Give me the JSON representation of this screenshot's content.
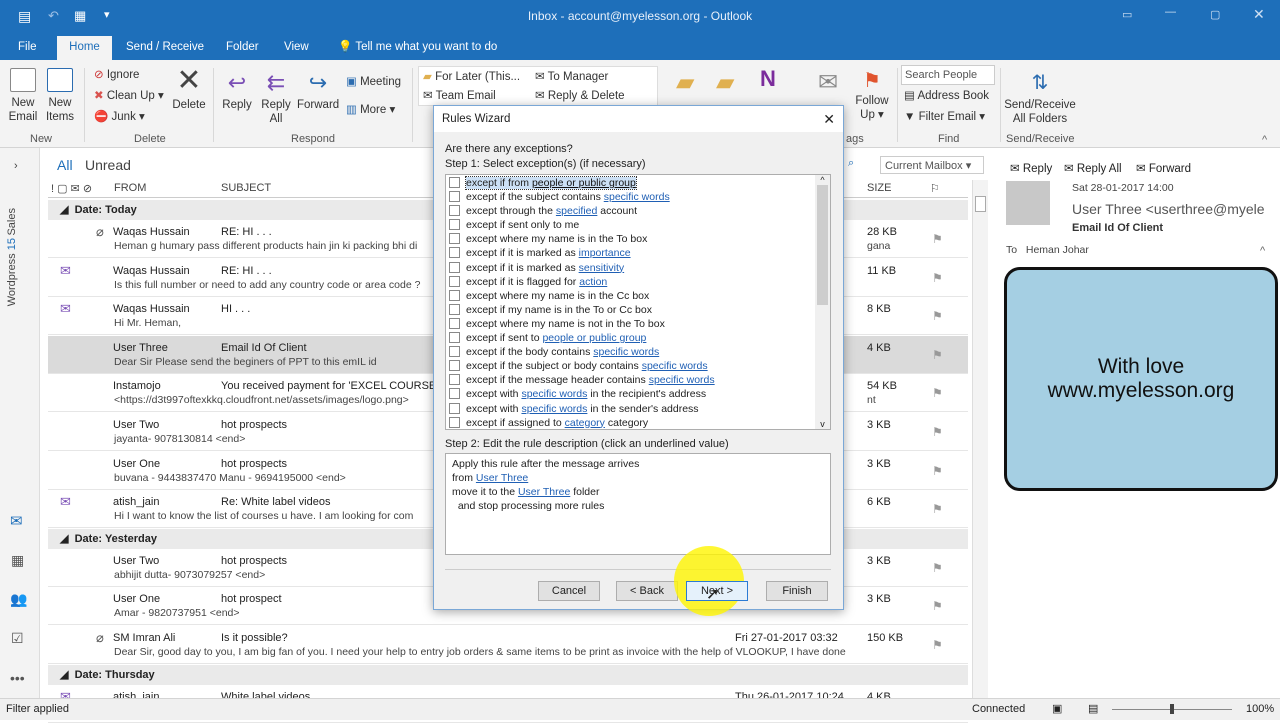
{
  "window": {
    "title": "Inbox - account@myelesson.org  -  Outlook"
  },
  "menu_tabs": [
    "File",
    "Home",
    "Send / Receive",
    "Folder",
    "View"
  ],
  "tell_me": "Tell me what you want to do",
  "ribbon": {
    "new_email": "New Email",
    "new_items": "New Items",
    "group_new": "New",
    "ignore": "Ignore",
    "clean_up": "Clean Up",
    "junk": "Junk",
    "delete": "Delete",
    "group_delete": "Delete",
    "reply": "Reply",
    "reply_all": "Reply All",
    "forward": "Forward",
    "meeting": "Meeting",
    "more": "More",
    "group_respond": "Respond",
    "qs": [
      "For Later (This...",
      "To Manager",
      "Team Email",
      "Reply & Delete"
    ],
    "follow_up": "Follow Up",
    "group_tags": "ags",
    "search_people": "Search People",
    "address_book": "Address Book",
    "filter_email": "Filter Email",
    "group_find": "Find",
    "send_receive_all": "Send/Receive All Folders",
    "group_send_receive": "Send/Receive"
  },
  "list": {
    "filter_all": "All",
    "filter_unread": "Unread",
    "scope": "Current Mailbox",
    "columns": {
      "from": "FROM",
      "subject": "SUBJECT",
      "size": "SIZE"
    },
    "groups": [
      {
        "label": "Date: Today",
        "rows": [
          {
            "from": "Waqas Hussain",
            "subject": "RE: HI . . .",
            "preview": "Heman g humary pass different products hain jin ki packing bhi di",
            "preview_tail": "gana",
            "size": "28 KB",
            "icon": "attachment"
          },
          {
            "from": "Waqas Hussain",
            "subject": "RE: HI . . .",
            "preview": "Is this full number or need to add any country code or area code ?",
            "size": "11 KB",
            "icon": "replied"
          },
          {
            "from": "Waqas Hussain",
            "subject": "HI . . .",
            "preview": "Hi Mr. Heman,",
            "size": "8 KB",
            "icon": "replied"
          },
          {
            "from": "User Three",
            "subject": "Email Id Of Client",
            "preview": "Dear Sir  Please send the beginers of PPT to this emIL id",
            "size": "4 KB",
            "selected": true
          },
          {
            "from": "Instamojo",
            "subject": "You received payment for 'EXCEL COURSE' o",
            "preview": "<https://d3t997oftexkkq.cloudfront.net/assets/images/logo.png>",
            "preview_tail": "nt",
            "size": "54 KB"
          },
          {
            "from": "User Two",
            "subject": "hot prospects",
            "preview": "jayanta- 9078130814 <end>",
            "size": "3 KB"
          },
          {
            "from": "User One",
            "subject": "hot prospects",
            "preview": "buvana - 9443837470  Manu - 9694195000 <end>",
            "size": "3 KB"
          },
          {
            "from": "atish_jain",
            "subject": "Re: White label videos",
            "preview": "Hi  I want to know the list of courses u have.  I am looking for com",
            "size": "6 KB",
            "icon": "replied"
          }
        ]
      },
      {
        "label": "Date: Yesterday",
        "rows": [
          {
            "from": "User Two",
            "subject": "hot prospects",
            "preview": "abhijit dutta- 9073079257 <end>",
            "size": "3 KB"
          },
          {
            "from": "User One",
            "subject": "hot prospect",
            "preview": "Amar - 9820737951 <end>",
            "size": "3 KB"
          },
          {
            "from": "SM Imran Ali",
            "subject": "Is it possible?",
            "preview": "Dear Sir, good day to you, I am big fan of you.  I need your help to entry job orders & same items to be print as invoice with the help of VLOOKUP, I have done",
            "date": "Fri 27-01-2017 03:32",
            "size": "150 KB",
            "icon": "attachment"
          }
        ]
      },
      {
        "label": "Date: Thursday",
        "rows": [
          {
            "from": "atish_jain",
            "subject": "White label videos",
            "date": "Thu 26-01-2017 10:24",
            "size": "4 KB",
            "icon": "replied"
          }
        ]
      }
    ]
  },
  "rail": {
    "sales": "Sales",
    "wordpress": "Wordpress",
    "wordpress_count": "15"
  },
  "reading": {
    "reply": "Reply",
    "reply_all": "Reply All",
    "forward": "Forward",
    "date": "Sat 28-01-2017 14:00",
    "sender": "User Three <userthree@myele",
    "subject": "Email Id Of Client",
    "to_label": "To",
    "to": "Heman Johar",
    "banner": [
      "With love",
      "www.myelesson.org"
    ]
  },
  "dialog": {
    "title": "Rules Wizard",
    "question": "Are there any exceptions?",
    "step1": "Step 1: Select exception(s) (if necessary)",
    "exceptions": [
      [
        "except if from ",
        "people or public group",
        ""
      ],
      [
        "except if the subject contains ",
        "specific words",
        ""
      ],
      [
        "except through the ",
        "specified",
        " account"
      ],
      [
        "except if sent only to me",
        "",
        ""
      ],
      [
        "except where my name is in the To box",
        "",
        ""
      ],
      [
        "except if it is marked as ",
        "importance",
        ""
      ],
      [
        "except if it is marked as ",
        "sensitivity",
        ""
      ],
      [
        "except if it is flagged for ",
        "action",
        ""
      ],
      [
        "except where my name is in the Cc box",
        "",
        ""
      ],
      [
        "except if my name is in the To or Cc box",
        "",
        ""
      ],
      [
        "except where my name is not in the To box",
        "",
        ""
      ],
      [
        "except if sent to ",
        "people or public group",
        ""
      ],
      [
        "except if the body contains ",
        "specific words",
        ""
      ],
      [
        "except if the subject or body contains ",
        "specific words",
        ""
      ],
      [
        "except if the message header contains ",
        "specific words",
        ""
      ],
      [
        "except with ",
        "specific words",
        " in the recipient's address"
      ],
      [
        "except with ",
        "specific words",
        " in the sender's address"
      ],
      [
        "except if assigned to ",
        "category",
        " category"
      ]
    ],
    "step2": "Step 2: Edit the rule description (click an underlined value)",
    "desc": {
      "l1": "Apply this rule after the message arrives",
      "l2a": "from ",
      "l2b": "User Three",
      "l3a": "move it to the ",
      "l3b": "User Three",
      "l3c": " folder",
      "l4": "  and stop processing more rules"
    },
    "cancel": "Cancel",
    "back": "< Back",
    "next": "Next >",
    "finish": "Finish"
  },
  "status": {
    "left": "Filter applied",
    "connected": "Connected",
    "zoom": "100%"
  }
}
